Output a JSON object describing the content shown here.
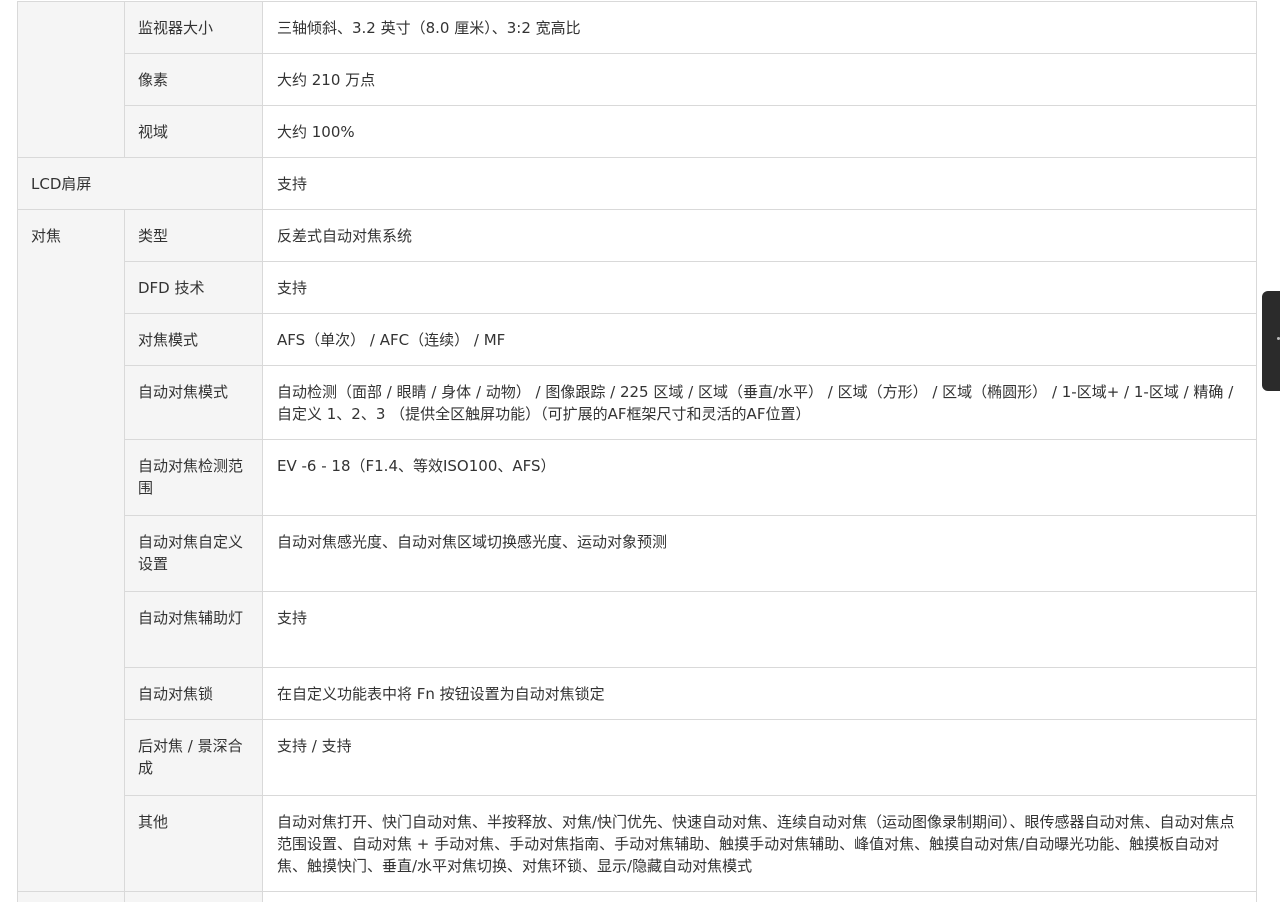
{
  "rows": [
    {
      "cat": "",
      "sub": "监视器大小",
      "val": "三轴倾斜、3.2 英寸（8.0 厘米）、3:2 宽高比"
    },
    {
      "cat": "",
      "sub": "像素",
      "val": "大约 210 万点"
    },
    {
      "cat": "",
      "sub": "视域",
      "val": "大约 100%"
    },
    {
      "cat": "LCD肩屏",
      "sub": "",
      "val": "支持"
    },
    {
      "cat": "对焦",
      "sub": "类型",
      "val": "反差式自动对焦系统"
    },
    {
      "cat": "",
      "sub": "DFD 技术",
      "val": "支持"
    },
    {
      "cat": "",
      "sub": "对焦模式",
      "val": "AFS（单次） / AFC（连续） / MF"
    },
    {
      "cat": "",
      "sub": "自动对焦模式",
      "val": "自动检测（面部 / 眼睛 / 身体 / 动物） / 图像跟踪 / 225 区域 / 区域（垂直/水平） / 区域（方形） / 区域（椭圆形） / 1-区域+ / 1-区域 / 精确 / 自定义 1、2、3 （提供全区触屏功能）（可扩展的AF框架尺寸和灵活的AF位置）"
    },
    {
      "cat": "",
      "sub": "自动对焦检测范围",
      "val": "EV -6 - 18（F1.4、等效ISO100、AFS）"
    },
    {
      "cat": "",
      "sub": "自动对焦自定义设置",
      "val": "自动对焦感光度、自动对焦区域切换感光度、运动对象预测"
    },
    {
      "cat": "",
      "sub": "自动对焦辅助灯",
      "val": "支持"
    },
    {
      "cat": "",
      "sub": "自动对焦锁",
      "val": "在自定义功能表中将 Fn 按钮设置为自动对焦锁定"
    },
    {
      "cat": "",
      "sub": "后对焦 / 景深合成",
      "val": "支持 / 支持"
    },
    {
      "cat": "",
      "sub": "其他",
      "val": "自动对焦打开、快门自动对焦、半按释放、对焦/快门优先、快速自动对焦、连续自动对焦（运动图像录制期间）、眼传感器自动对焦、自动对焦点范围设置、自动对焦 + 手动对焦、手动对焦指南、手动对焦辅助、触摸手动对焦辅助、峰值对焦、触摸自动对焦/自动曝光功能、触摸板自动对焦、触摸快门、垂直/水平对焦切换、对焦环锁、显示/隐藏自动对焦模式"
    }
  ]
}
